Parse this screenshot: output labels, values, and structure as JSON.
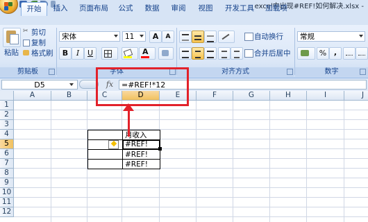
{
  "window": {
    "title": "excel中出现#REF!如何解决.xlsx -"
  },
  "tabs": [
    "开始",
    "插入",
    "页面布局",
    "公式",
    "数据",
    "审阅",
    "视图",
    "开发工具",
    "加载项"
  ],
  "clipboard": {
    "paste": "粘贴",
    "cut": "剪切",
    "copy": "复制",
    "format_painter": "格式刷",
    "group": "剪贴板"
  },
  "font": {
    "name": "宋体",
    "size": "11",
    "bold": "B",
    "italic": "I",
    "underline": "U",
    "font_color_letter": "A",
    "grow": "A",
    "shrink": "A",
    "group": "字体"
  },
  "alignment": {
    "wrap": "自动换行",
    "merge": "合并后居中",
    "group": "对齐方式"
  },
  "number": {
    "format": "常规",
    "percent": "%",
    "comma": ",",
    "group": "数字"
  },
  "formula_bar": {
    "name_box": "D5",
    "fx": "fx",
    "formula": "=#REF!*12"
  },
  "sheet": {
    "columns": [
      "A",
      "B",
      "C",
      "D",
      "E",
      "F",
      "G",
      "H",
      "I",
      "J"
    ],
    "rows": [
      "1",
      "2",
      "3",
      "4",
      "5",
      "6",
      "7",
      "8",
      "9",
      "10",
      "11",
      "12"
    ],
    "header_d4": "月收入",
    "error_values": [
      "#REF!",
      "#REF!",
      "#REF!"
    ],
    "warning_symbol": "!"
  },
  "colors": {
    "annotation_red": "#e2212a",
    "selected_header": "#f1c15f",
    "ribbon_bg": "#dbe7f7"
  }
}
